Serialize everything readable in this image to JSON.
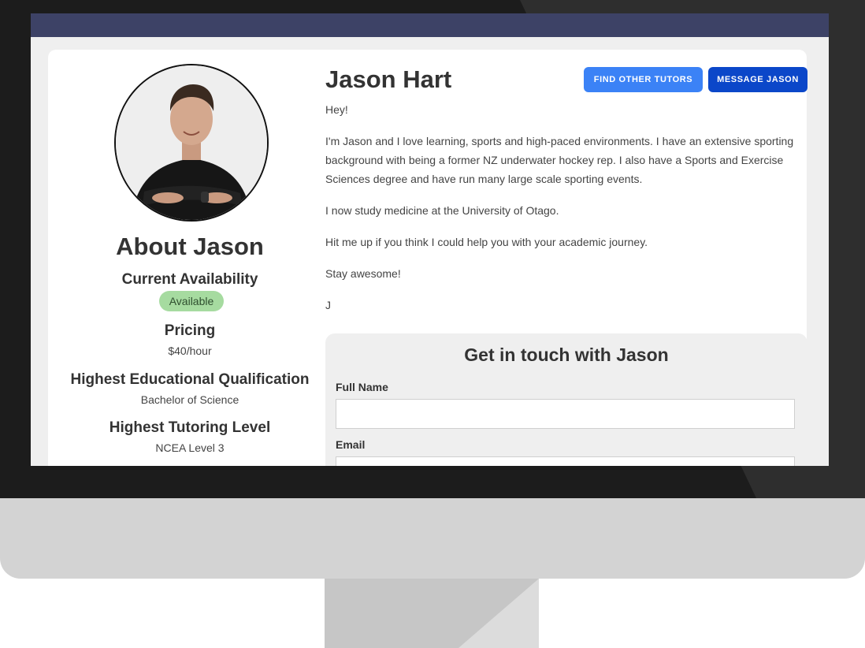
{
  "profile": {
    "name": "Jason Hart",
    "buttons": {
      "find_other_tutors": "FIND OTHER TUTORS",
      "message": "MESSAGE JASON"
    },
    "bio": [
      "Hey!",
      "I'm Jason and I love learning, sports and high-paced environments. I have an extensive sporting background with being a former NZ underwater hockey rep. I also have a Sports and Exercise Sciences degree and have run many large scale sporting events.",
      "I now study medicine at the University of Otago.",
      "Hit me up if you think I could help you with your academic journey.",
      "Stay awesome!",
      "J"
    ]
  },
  "about": {
    "title": "About Jason",
    "availability_label": "Current Availability",
    "availability_status": "Available",
    "pricing_label": "Pricing",
    "pricing_value": "$40/hour",
    "qualification_label": "Highest Educational Qualification",
    "qualification_value": "Bachelor of Science",
    "tutoring_level_label": "Highest Tutoring Level",
    "tutoring_level_value": "NCEA Level 3"
  },
  "contact_form": {
    "title": "Get in touch with Jason",
    "full_name_label": "Full Name",
    "full_name_value": "",
    "email_label": "Email",
    "email_value": ""
  },
  "colors": {
    "topbar": "#3d4266",
    "find_button": "#3b82f6",
    "message_button": "#0b47c9",
    "available_badge": "#a6dba0"
  }
}
